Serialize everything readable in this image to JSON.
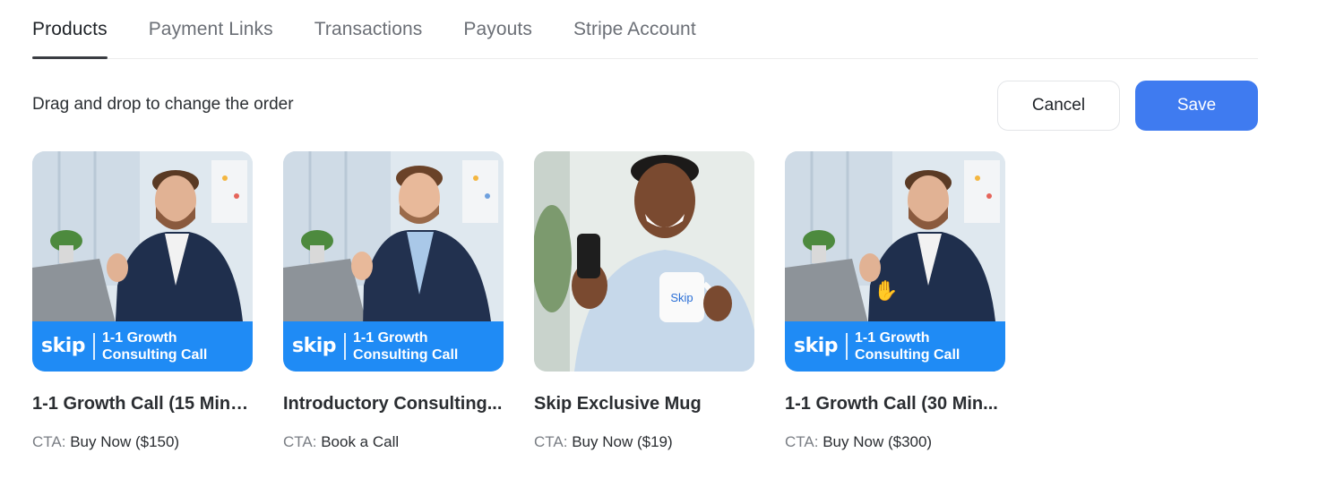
{
  "tabs": [
    {
      "label": "Products",
      "active": true
    },
    {
      "label": "Payment Links",
      "active": false
    },
    {
      "label": "Transactions",
      "active": false
    },
    {
      "label": "Payouts",
      "active": false
    },
    {
      "label": "Stripe Account",
      "active": false
    }
  ],
  "toolbar": {
    "instruction": "Drag and drop to change the order",
    "cancel_label": "Cancel",
    "save_label": "Save"
  },
  "products": [
    {
      "title": "1-1 Growth Call (15 Minu...",
      "cta_prefix": "CTA:",
      "cta": "Buy Now ($150)",
      "banner_logo": "skip",
      "banner_line1": "1-1 Growth",
      "banner_line2": "Consulting Call"
    },
    {
      "title": "Introductory Consulting...",
      "cta_prefix": "CTA:",
      "cta": "Book a Call",
      "banner_logo": "skip",
      "banner_line1": "1-1 Growth",
      "banner_line2": "Consulting Call"
    },
    {
      "title": "Skip Exclusive Mug",
      "cta_prefix": "CTA:",
      "cta": "Buy Now ($19)",
      "mug_text": "Skip"
    },
    {
      "title": "1-1 Growth Call (30 Min...",
      "cta_prefix": "CTA:",
      "cta": "Buy Now ($300)",
      "banner_logo": "skip",
      "banner_line1": "1-1 Growth",
      "banner_line2": "Consulting Call"
    }
  ],
  "colors": {
    "accent": "#3f7bf0",
    "banner": "#1f8bf5"
  }
}
